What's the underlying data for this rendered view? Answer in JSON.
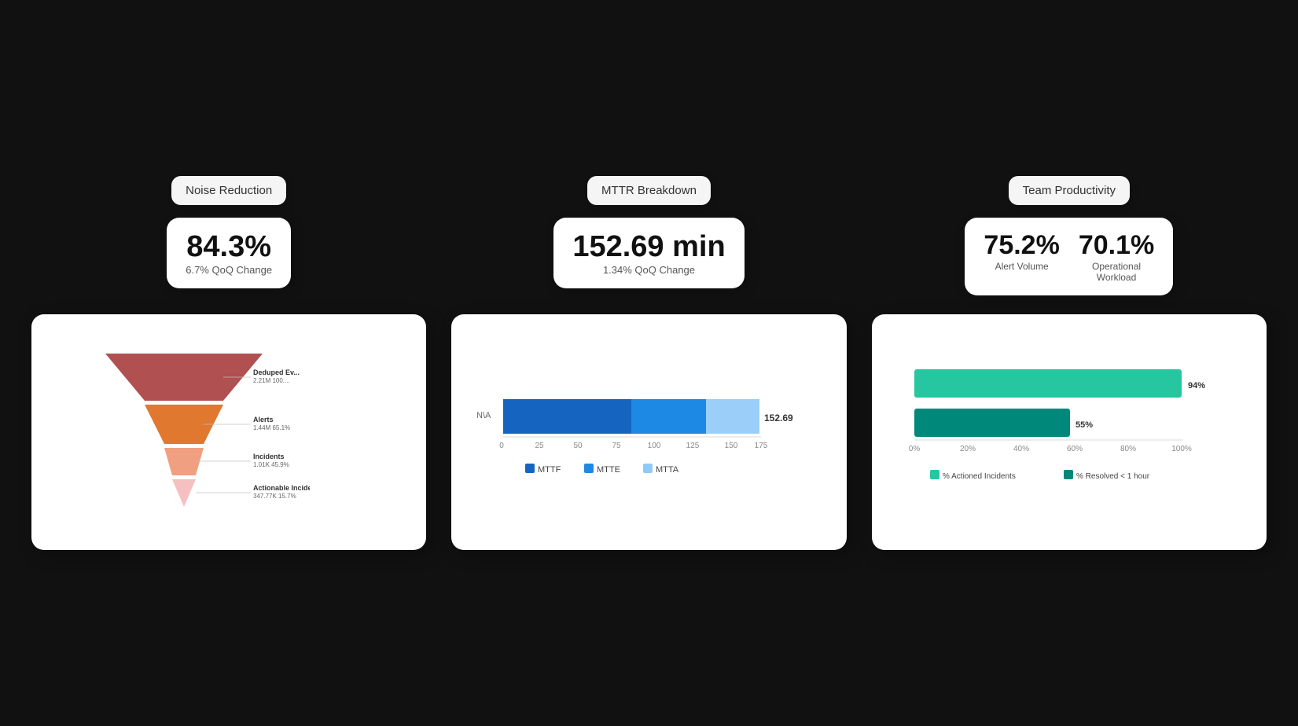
{
  "noiseReduction": {
    "title": "Noise Reduction",
    "value": "84.3%",
    "change": "6.7% QoQ Change"
  },
  "mttrBreakdown": {
    "title": "MTTR Breakdown",
    "value": "152.69 min",
    "change": "1.34% QoQ Change"
  },
  "teamProductivity": {
    "title": "Team Productivity",
    "value1": "75.2%",
    "label1": "Alert Volume",
    "value2": "70.1%",
    "label2": "Operational Workload"
  },
  "funnel": {
    "items": [
      {
        "name": "Deduped Ev...",
        "value": "2.21M 100....",
        "color": "#b05050"
      },
      {
        "name": "Alerts",
        "value": "1.44M 65.1%",
        "color": "#e07830"
      },
      {
        "name": "Incidents",
        "value": "1.01K 45.9%",
        "color": "#f0a080"
      },
      {
        "name": "Actionable Incidents",
        "value": "347.77K 15.7%",
        "color": "#f5c0c0"
      }
    ]
  },
  "mttrChart": {
    "yLabel": "N\\A",
    "endLabel": "152.69",
    "xAxis": [
      "0",
      "25",
      "50",
      "75",
      "100",
      "125",
      "150",
      "175"
    ],
    "segments": [
      {
        "label": "MTTF",
        "color": "#1565c0",
        "pct": 48
      },
      {
        "label": "MTTE",
        "color": "#1e88e5",
        "pct": 28
      },
      {
        "label": "MTTA",
        "color": "#90caf9",
        "pct": 24
      }
    ]
  },
  "productivityChart": {
    "bars": [
      {
        "label": "% Actioned Incidents",
        "pct": 94,
        "color": "#26c6a0",
        "pctLabel": "94%"
      },
      {
        "label": "% Resolved < 1 hour",
        "pct": 55,
        "color": "#00897b",
        "pctLabel": "55%"
      }
    ],
    "xAxis": [
      "0%",
      "20%",
      "40%",
      "60%",
      "80%",
      "100%"
    ]
  }
}
